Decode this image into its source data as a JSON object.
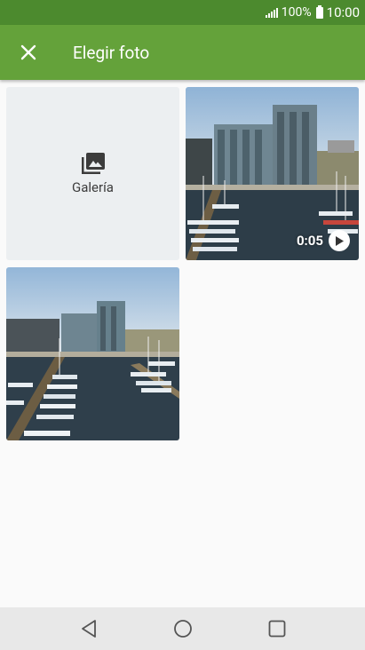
{
  "status_bar": {
    "battery_percent": "100%",
    "time": "10:00"
  },
  "app_bar": {
    "title": "Elegir foto",
    "close_icon": "close-icon"
  },
  "grid": {
    "gallery_tile": {
      "label": "Galería",
      "icon": "gallery-icon"
    },
    "video_tile": {
      "duration": "0:05",
      "icon": "play-icon"
    }
  },
  "nav_bar": {
    "icons": [
      "back-icon",
      "home-icon",
      "recents-icon"
    ]
  },
  "colors": {
    "status_bar": "#4c8a2e",
    "app_bar": "#64a23a",
    "background": "#fafafa"
  }
}
